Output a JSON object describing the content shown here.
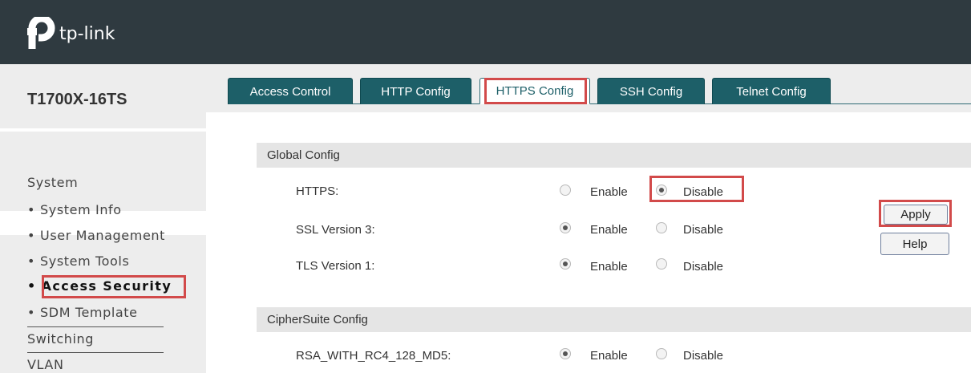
{
  "header": {
    "brand": "tp-link"
  },
  "sidebar": {
    "model": "T1700X-16TS",
    "items": [
      {
        "label": "System",
        "sub": false
      },
      {
        "label": "System Info",
        "sub": true
      },
      {
        "label": "User Management",
        "sub": true
      },
      {
        "label": "System Tools",
        "sub": true
      },
      {
        "label": "Access Security",
        "sub": true,
        "active": true
      },
      {
        "label": "SDM Template",
        "sub": true
      },
      {
        "label": "Switching",
        "sub": false
      },
      {
        "label": "VLAN",
        "sub": false
      }
    ]
  },
  "tabs": [
    {
      "label": "Access Control"
    },
    {
      "label": "HTTP Config"
    },
    {
      "label": "HTTPS Config",
      "selected": true
    },
    {
      "label": "SSH Config"
    },
    {
      "label": "Telnet Config"
    }
  ],
  "global_config": {
    "title": "Global Config",
    "rows": [
      {
        "label": "HTTPS:",
        "selected": "Disable"
      },
      {
        "label": "SSL Version 3:",
        "selected": "Enable"
      },
      {
        "label": "TLS Version 1:",
        "selected": "Enable"
      }
    ],
    "enable_label": "Enable",
    "disable_label": "Disable"
  },
  "buttons": {
    "apply": "Apply",
    "help": "Help"
  },
  "ciphersuite_config": {
    "title": "CipherSuite Config",
    "rows": [
      {
        "label": "RSA_WITH_RC4_128_MD5:",
        "selected": "Enable"
      }
    ],
    "enable_label": "Enable",
    "disable_label": "Disable"
  },
  "colors": {
    "header_bg": "#2f3a40",
    "tab_bg": "#1d5f68",
    "highlight": "#d24a4a",
    "sidebar_bg": "#ededed"
  }
}
